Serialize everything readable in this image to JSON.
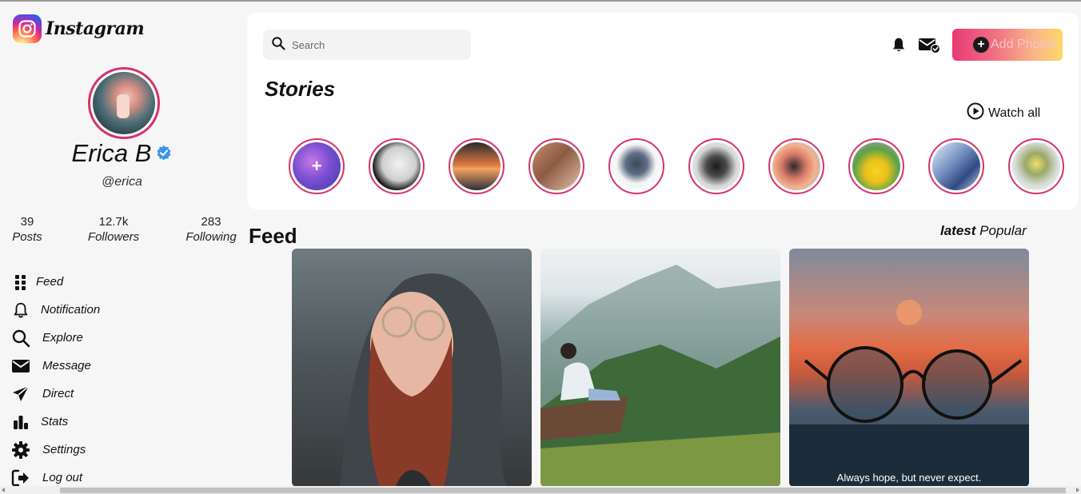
{
  "app": {
    "name": "Instagram"
  },
  "profile": {
    "name": "Erica B",
    "handle": "@erica",
    "verified": true,
    "stats": [
      {
        "value": "39",
        "label": "Posts"
      },
      {
        "value": "12.7k",
        "label": "Followers"
      },
      {
        "value": "283",
        "label": "Following"
      }
    ]
  },
  "nav": {
    "items": [
      {
        "label": "Feed",
        "icon": "grid-icon"
      },
      {
        "label": "Notification",
        "icon": "bell-icon"
      },
      {
        "label": "Explore",
        "icon": "search-icon"
      },
      {
        "label": "Message",
        "icon": "envelope-icon"
      },
      {
        "label": "Direct",
        "icon": "paper-plane-icon"
      },
      {
        "label": "Stats",
        "icon": "bar-chart-icon"
      },
      {
        "label": "Settings",
        "icon": "gear-icon"
      },
      {
        "label": "Log out",
        "icon": "logout-icon"
      }
    ]
  },
  "header": {
    "search_placeholder": "Search",
    "add_photos_label": "Add Photos"
  },
  "stories": {
    "title": "Stories",
    "watch_all_label": "Watch all",
    "count": 10
  },
  "feed": {
    "title": "Feed",
    "tabs": {
      "latest": "latest",
      "popular": "Popular"
    },
    "posts": [
      {
        "caption": ""
      },
      {
        "caption": ""
      },
      {
        "caption": "Always hope, but never expect."
      }
    ]
  },
  "colors": {
    "accent": "#d6336c",
    "verified": "#3b95e8",
    "add_gradient_start": "#e73a73",
    "add_gradient_end": "#fbd766"
  }
}
